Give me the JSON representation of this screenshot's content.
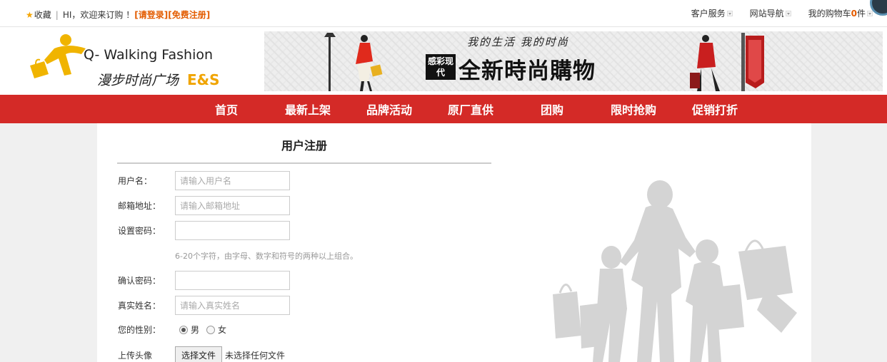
{
  "topbar": {
    "favorite": "收藏",
    "welcome": "HI，欢迎来订购 ！",
    "login": "[请登录]",
    "register": "[免费注册]",
    "customer_service": "客户服务",
    "site_nav": "网站导航",
    "cart_prefix": "我的购物车",
    "cart_count": "0",
    "cart_suffix": "件"
  },
  "logo": {
    "en": "Q- Walking Fashion",
    "cn": "漫步时尚广场",
    "es": "E&S"
  },
  "banner": {
    "script": "我的生活  我的时尚",
    "seal": "感彩现代",
    "title": "全新時尚購物"
  },
  "nav": {
    "items": [
      "首页",
      "最新上架",
      "品牌活动",
      "原厂直供",
      "团购",
      "限时抢购",
      "促销打折"
    ]
  },
  "form": {
    "title": "用户注册",
    "username_label": "用户名：",
    "username_placeholder": "请输入用户名",
    "email_label": "邮箱地址：",
    "email_placeholder": "请输入邮箱地址",
    "password_label": "设置密码：",
    "password_hint": "6-20个字符，由字母、数字和符号的两种以上组合。",
    "confirm_label": "确认密码：",
    "realname_label": "真实姓名：",
    "realname_placeholder": "请输入真实姓名",
    "gender_label": "您的性别：",
    "gender_male": "男",
    "gender_female": "女",
    "gender_selected": "男",
    "avatar_label": "上传头像",
    "file_button": "选择文件",
    "file_none": "未选择任何文件"
  },
  "colors": {
    "accent": "#d42a27",
    "link_orange": "#e35c00",
    "logo_yellow": "#f0a400"
  }
}
